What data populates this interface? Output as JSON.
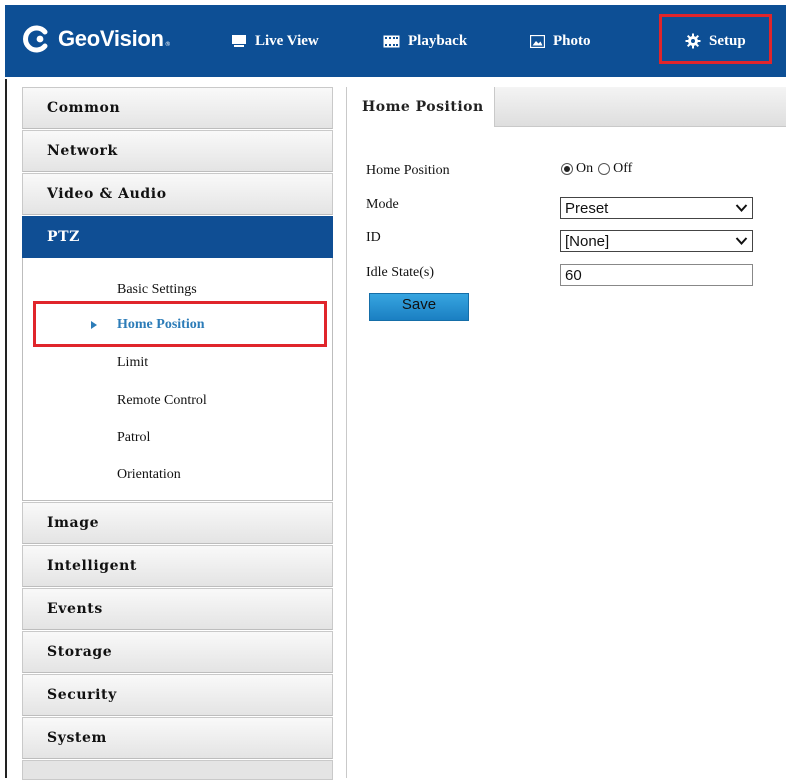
{
  "brand": {
    "name": "GeoVision",
    "mark": "®"
  },
  "nav": {
    "items": [
      {
        "label": "Live View",
        "icon": "monitor-icon"
      },
      {
        "label": "Playback",
        "icon": "film-icon"
      },
      {
        "label": "Photo",
        "icon": "photo-icon"
      },
      {
        "label": "Setup",
        "icon": "gear-icon",
        "active": true
      }
    ]
  },
  "sidebar": {
    "items_top": [
      "Common",
      "Network",
      "Video & Audio"
    ],
    "active_item": "PTZ",
    "submenu": [
      "Basic Settings",
      "Home Position",
      "Limit",
      "Remote Control",
      "Patrol",
      "Orientation"
    ],
    "current_submenu": "Home Position",
    "items_bottom": [
      "Image",
      "Intelligent",
      "Events",
      "Storage",
      "Security",
      "System"
    ]
  },
  "main": {
    "tab": "Home Position",
    "form": {
      "home_position": {
        "label": "Home Position",
        "on_label": "On",
        "off_label": "Off",
        "value": "On"
      },
      "mode": {
        "label": "Mode",
        "value": "Preset"
      },
      "id": {
        "label": "ID",
        "value": "[None]"
      },
      "idle_state": {
        "label": "Idle State(s)",
        "value": "60"
      },
      "save_label": "Save"
    }
  },
  "colors": {
    "topbar": "#0d4f95",
    "active_menu": "#0f4e94",
    "highlight": "#e0252b",
    "save_button": "#1a7fc2",
    "current_link": "#2c7cb8"
  }
}
